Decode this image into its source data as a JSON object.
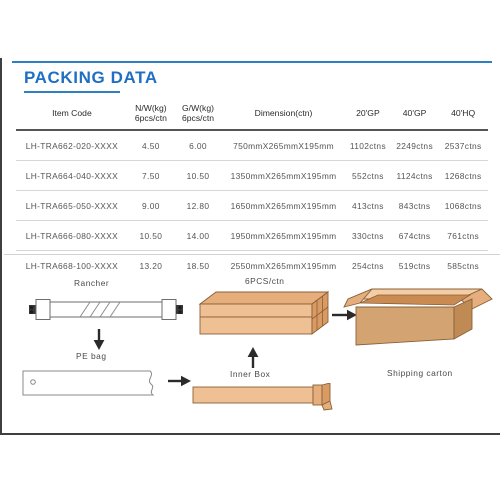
{
  "document": {
    "title": "PACKING DATA"
  },
  "table": {
    "headers": [
      {
        "line1": "Item Code",
        "line2": ""
      },
      {
        "line1": "N/W(kg)",
        "line2": "6pcs/ctn"
      },
      {
        "line1": "G/W(kg)",
        "line2": "6pcs/ctn"
      },
      {
        "line1": "Dimension(ctn)",
        "line2": ""
      },
      {
        "line1": "20'GP",
        "line2": ""
      },
      {
        "line1": "40'GP",
        "line2": ""
      },
      {
        "line1": "40'HQ",
        "line2": ""
      }
    ],
    "rows": [
      {
        "item_code": "LH-TRA662-020-XXXX",
        "nw": "4.50",
        "gw": "6.00",
        "dimension": "750mmX265mmX195mm",
        "gp20": "1102ctns",
        "gp40": "2249ctns",
        "hq40": "2537ctns"
      },
      {
        "item_code": "LH-TRA664-040-XXXX",
        "nw": "7.50",
        "gw": "10.50",
        "dimension": "1350mmX265mmX195mm",
        "gp20": "552ctns",
        "gp40": "1124ctns",
        "hq40": "1268ctns"
      },
      {
        "item_code": "LH-TRA665-050-XXXX",
        "nw": "9.00",
        "gw": "12.80",
        "dimension": "1650mmX265mmX195mm",
        "gp20": "413ctns",
        "gp40": "843ctns",
        "hq40": "1068ctns"
      },
      {
        "item_code": "LH-TRA666-080-XXXX",
        "nw": "10.50",
        "gw": "14.00",
        "dimension": "1950mmX265mmX195mm",
        "gp20": "330ctns",
        "gp40": "674ctns",
        "hq40": "761ctns"
      },
      {
        "item_code": "LH-TRA668-100-XXXX",
        "nw": "13.20",
        "gw": "18.50",
        "dimension": "2550mmX265mmX195mm",
        "gp20": "254ctns",
        "gp40": "519ctns",
        "hq40": "585ctns"
      }
    ]
  },
  "diagram": {
    "labels": {
      "rancher": "Rancher",
      "pe_bag": "PE bag",
      "pcs_per_ctn": "6PCS/ctn",
      "inner_box": "Inner Box",
      "shipping_carton": "Shipping carton"
    }
  },
  "colors": {
    "title_blue": "#1f6fc4",
    "rule_blue": "#2f7fc4",
    "carton_face": "#efc094",
    "carton_top": "#e5ae7c",
    "carton_side": "#d99a63",
    "carton_outline": "#8a6038",
    "panel_border": "#3f3f3f",
    "header_rule": "#555555",
    "row_rule": "#d7d7d7",
    "text_gray": "#555555",
    "arrow": "#2b2b2b"
  }
}
